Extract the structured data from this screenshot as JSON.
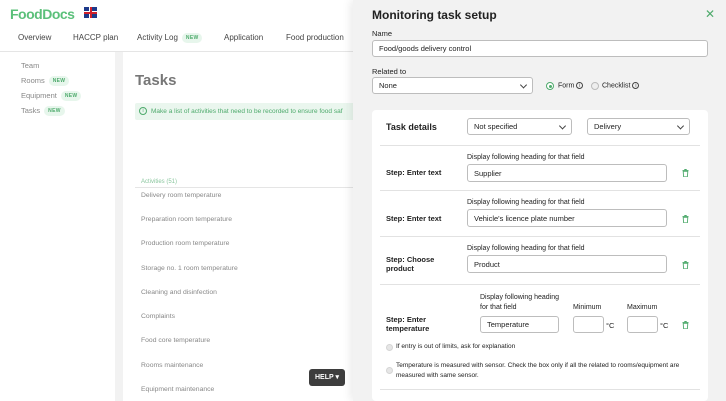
{
  "app": {
    "logo": "FoodDocs",
    "nav": [
      {
        "label": "Overview",
        "badge": ""
      },
      {
        "label": "HACCP plan",
        "badge": ""
      },
      {
        "label": "Activity Log",
        "badge": "NEW"
      },
      {
        "label": "Application",
        "badge": ""
      },
      {
        "label": "Food production",
        "badge": ""
      }
    ],
    "sidebar": [
      {
        "label": "Team",
        "badge": ""
      },
      {
        "label": "Rooms",
        "badge": "NEW"
      },
      {
        "label": "Equipment",
        "badge": "NEW"
      },
      {
        "label": "Tasks",
        "badge": "NEW"
      }
    ],
    "page_title": "Tasks",
    "info_text": "Make a list of activities that need to be recorded to ensure food saf",
    "activities_label": "Activities (51)",
    "activities": [
      "Delivery room temperature",
      "Preparation room temperature",
      "Production room temperature",
      "Storage no. 1 room temperature",
      "Cleaning and disinfection",
      "Complaints",
      "Food core temperature",
      "Rooms maintenance",
      "Equipment maintenance"
    ],
    "help_label": "HELP ▾"
  },
  "panel": {
    "title": "Monitoring task setup",
    "close_icon": "close-icon",
    "name_label": "Name",
    "name_value": "Food/goods delivery control",
    "related_label": "Related to",
    "related_value": "None",
    "radio_form": "Form",
    "radio_checklist": "Checklist",
    "selected_type": "Form",
    "task_details": {
      "title": "Task details",
      "select_1": "Not specified",
      "select_2": "Delivery",
      "heading_label": "Display following heading for that field",
      "steps": [
        {
          "label": "Step: Enter text",
          "value": "Supplier"
        },
        {
          "label": "Step: Enter text",
          "value": "Vehicle's licence plate number"
        },
        {
          "label": "Step: Choose product",
          "value": "Product"
        }
      ],
      "temp_step": {
        "label": "Step: Enter temperature",
        "heading_label": "Display following heading for that field",
        "value": "Temperature",
        "min_label": "Minimum",
        "max_label": "Maximum",
        "min_value": "",
        "max_value": "",
        "unit": "°C",
        "check_1": "If entry is out of limits, ask for explanation",
        "check_2": "Temperature is measured with sensor. Check the box only if all the related to rooms/equipment are measured with same sensor."
      }
    }
  },
  "colors": {
    "accent": "#4eaa6c",
    "panel_bg": "#f2f2f2",
    "help_bg": "#3d3d3d"
  }
}
